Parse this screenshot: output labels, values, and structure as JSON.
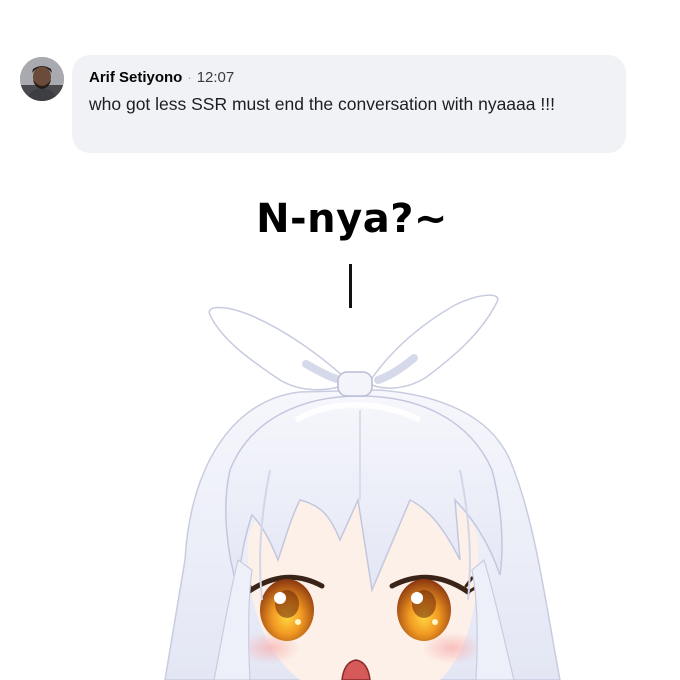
{
  "comment": {
    "author": "Arif Setiyono",
    "separator": "·",
    "time": "12:07",
    "message": "who got less SSR must end the conversation with nyaaaa !!!"
  },
  "speech": {
    "text": "N-nya?~"
  },
  "icons": {
    "avatar": "user-avatar-photo",
    "illustration": "anime-girl-with-bow"
  },
  "colors": {
    "bubble": "#f0f2f5",
    "hair": "#eef0fa",
    "eyes": "#e0841c"
  }
}
